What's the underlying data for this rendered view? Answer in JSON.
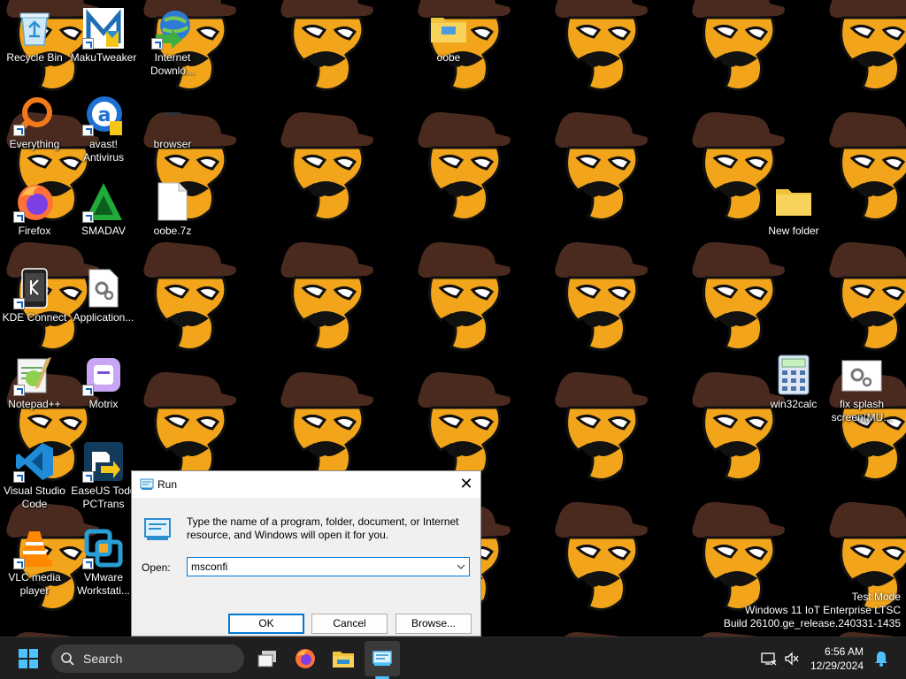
{
  "desktop": {
    "icons": [
      {
        "id": "recycle-bin",
        "label": "Recycle Bin",
        "glyph": "recycle-bin-icon"
      },
      {
        "id": "makutweaker",
        "label": "MakuTweaker",
        "glyph": "makutweaker-icon"
      },
      {
        "id": "idm",
        "label": "Internet Downlo...",
        "glyph": "internet-download-manager-icon"
      },
      {
        "id": "oobe",
        "label": "oobe",
        "glyph": "folder-icon"
      },
      {
        "id": "everything",
        "label": "Everything",
        "glyph": "everything-search-icon"
      },
      {
        "id": "avast",
        "label": "avast! Antivirus",
        "glyph": "avast-icon"
      },
      {
        "id": "browser",
        "label": "browser",
        "glyph": "browser-icon"
      },
      {
        "id": "firefox",
        "label": "Firefox",
        "glyph": "firefox-icon"
      },
      {
        "id": "smadav",
        "label": "SMADAV",
        "glyph": "smadav-icon"
      },
      {
        "id": "oobe7z",
        "label": "oobe.7z",
        "glyph": "file-icon"
      },
      {
        "id": "new-folder",
        "label": "New folder",
        "glyph": "folder-icon"
      },
      {
        "id": "kde-connect",
        "label": "KDE Connect",
        "glyph": "kde-connect-icon"
      },
      {
        "id": "application",
        "label": "Application...",
        "glyph": "application-settings-icon"
      },
      {
        "id": "notepadpp",
        "label": "Notepad++",
        "glyph": "notepad-plus-plus-icon"
      },
      {
        "id": "motrix",
        "label": "Motrix",
        "glyph": "motrix-icon"
      },
      {
        "id": "win32calc",
        "label": "win32calc",
        "glyph": "calculator-icon"
      },
      {
        "id": "fix-splash",
        "label": "fix splash screen(MU...",
        "glyph": "settings-file-icon"
      },
      {
        "id": "vscode",
        "label": "Visual Studio Code",
        "glyph": "vscode-icon"
      },
      {
        "id": "easeus",
        "label": "EaseUS Todo PCTrans",
        "glyph": "easeus-icon"
      },
      {
        "id": "vlc",
        "label": "VLC media player",
        "glyph": "vlc-icon"
      },
      {
        "id": "vmware",
        "label": "VMware Workstati...",
        "glyph": "vmware-icon"
      }
    ]
  },
  "watermark": {
    "line1": "Test Mode",
    "line2": "Windows 11 IoT Enterprise LTSC",
    "line3": "Build 26100.ge_release.240331-1435"
  },
  "run_dialog": {
    "title": "Run",
    "close_glyph": "✕",
    "description": "Type the name of a program, folder, document, or Internet resource, and Windows will open it for you.",
    "open_label": "Open:",
    "open_value": "msconfi",
    "ok_label": "OK",
    "cancel_label": "Cancel",
    "browse_label": "Browse..."
  },
  "taskbar": {
    "search_label": "Search",
    "clock_time": "6:56 AM",
    "clock_date": "12/29/2024"
  },
  "colors": {
    "accent": "#0078d4",
    "taskbar_bg": "#1f1f1f",
    "wallpaper_fill": "#f2a51a",
    "wallpaper_hat": "#4a2a1f"
  }
}
